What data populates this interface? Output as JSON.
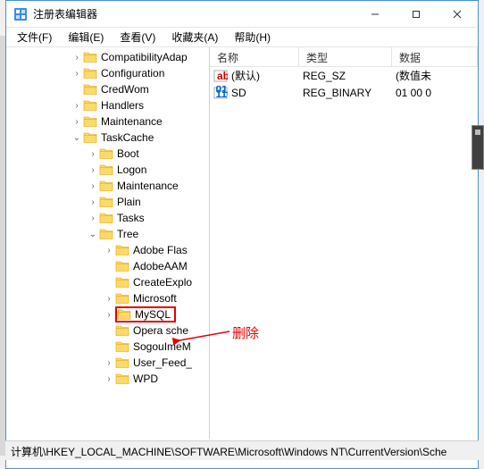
{
  "window": {
    "title": "注册表编辑器"
  },
  "menu": {
    "file": "文件(F)",
    "edit": "编辑(E)",
    "view": "查看(V)",
    "favorites": "收藏夹(A)",
    "help": "帮助(H)"
  },
  "tree": {
    "items": [
      {
        "indent": 72,
        "exp": "›",
        "label": "CompatibilityAdap"
      },
      {
        "indent": 72,
        "exp": "›",
        "label": "Configuration"
      },
      {
        "indent": 72,
        "exp": "",
        "label": "CredWom"
      },
      {
        "indent": 72,
        "exp": "›",
        "label": "Handlers"
      },
      {
        "indent": 72,
        "exp": "›",
        "label": "Maintenance"
      },
      {
        "indent": 72,
        "exp": "⌄",
        "label": "TaskCache"
      },
      {
        "indent": 90,
        "exp": "›",
        "label": "Boot"
      },
      {
        "indent": 90,
        "exp": "›",
        "label": "Logon"
      },
      {
        "indent": 90,
        "exp": "›",
        "label": "Maintenance"
      },
      {
        "indent": 90,
        "exp": "›",
        "label": "Plain"
      },
      {
        "indent": 90,
        "exp": "›",
        "label": "Tasks"
      },
      {
        "indent": 90,
        "exp": "⌄",
        "label": "Tree"
      },
      {
        "indent": 108,
        "exp": "›",
        "label": "Adobe Flas"
      },
      {
        "indent": 108,
        "exp": "",
        "label": "AdobeAAM"
      },
      {
        "indent": 108,
        "exp": "",
        "label": "CreateExplo"
      },
      {
        "indent": 108,
        "exp": "›",
        "label": "Microsoft"
      },
      {
        "indent": 108,
        "exp": "›",
        "label": "MySQL",
        "highlighted": true
      },
      {
        "indent": 108,
        "exp": "",
        "label": "Opera sche"
      },
      {
        "indent": 108,
        "exp": "",
        "label": "SogouImeM"
      },
      {
        "indent": 108,
        "exp": "›",
        "label": "User_Feed_"
      },
      {
        "indent": 108,
        "exp": "›",
        "label": "WPD"
      }
    ]
  },
  "list": {
    "headers": {
      "name": "名称",
      "type": "类型",
      "data": "数据"
    },
    "rows": [
      {
        "icon": "string",
        "name": "(默认)",
        "type": "REG_SZ",
        "data": "(数值未"
      },
      {
        "icon": "binary",
        "name": "SD",
        "type": "REG_BINARY",
        "data": "01 00 0"
      }
    ]
  },
  "annotation": {
    "text": "删除"
  },
  "statusbar": {
    "path": "计算机\\HKEY_LOCAL_MACHINE\\SOFTWARE\\Microsoft\\Windows NT\\CurrentVersion\\Sche"
  }
}
